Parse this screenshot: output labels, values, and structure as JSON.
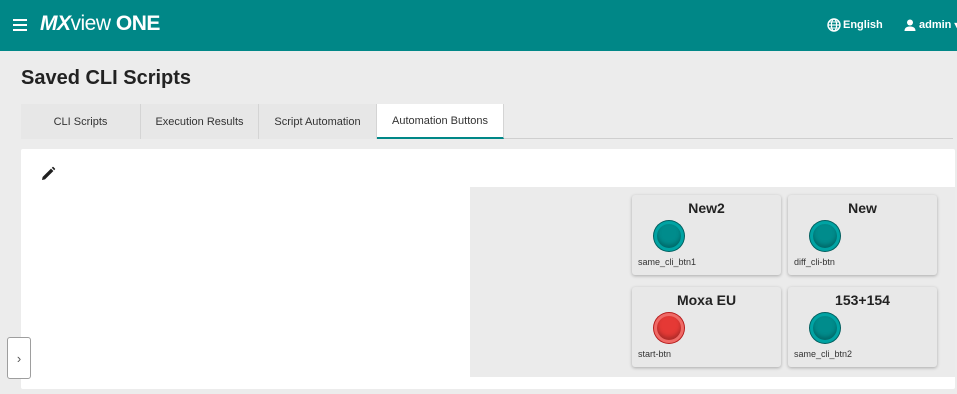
{
  "header": {
    "logo": {
      "part1": "MX",
      "part2": "view ",
      "part3": "ONE"
    },
    "language": "English",
    "user": "admin",
    "caret": "▼",
    "bg_color": "#008787"
  },
  "page": {
    "title": "Saved CLI Scripts"
  },
  "tabs": [
    {
      "label": "CLI Scripts",
      "active": false
    },
    {
      "label": "Execution Results",
      "active": false
    },
    {
      "label": "Script Automation",
      "active": false
    },
    {
      "label": "Automation Buttons",
      "active": true
    }
  ],
  "panel": {
    "edit_icon": "pencil-icon"
  },
  "automation_buttons": [
    {
      "title": "New2",
      "label": "same_cli_btn1",
      "color": "teal"
    },
    {
      "title": "New",
      "label": "diff_cli-btn",
      "color": "teal"
    },
    {
      "title": "Moxa EU",
      "label": "start-btn",
      "color": "red"
    },
    {
      "title": "153+154",
      "label": "same_cli_btn2",
      "color": "teal"
    }
  ],
  "sidebar_toggle": {
    "glyph": "›"
  }
}
